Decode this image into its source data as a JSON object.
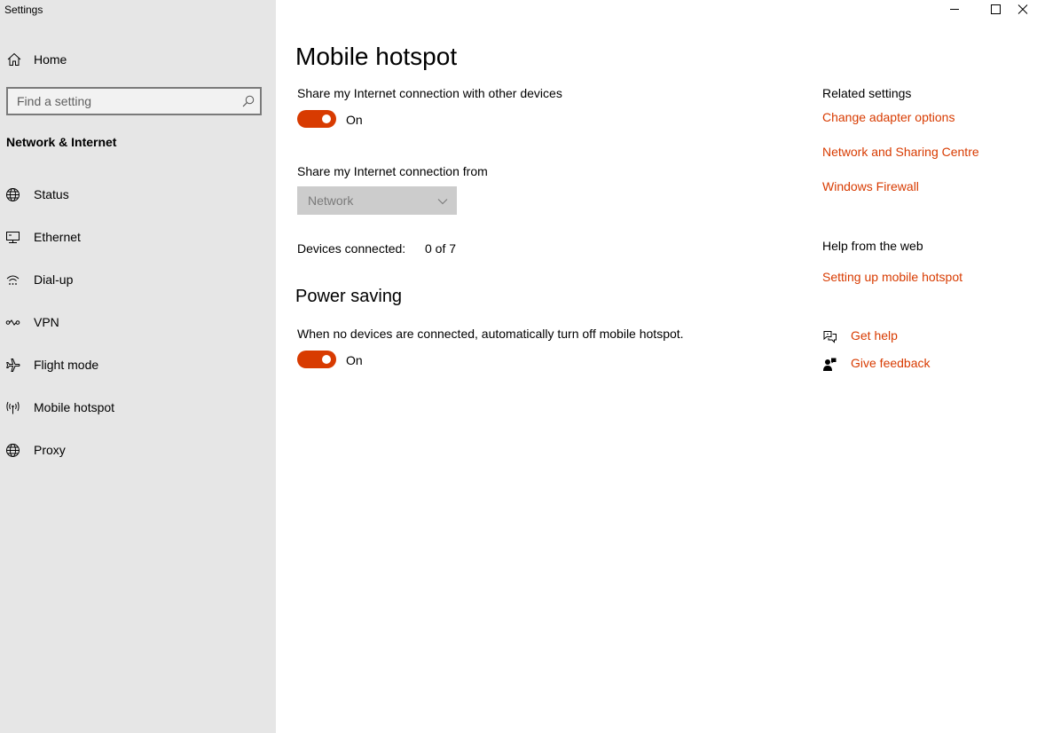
{
  "window": {
    "app_title": "Settings",
    "controls": {
      "minimize_icon": "minimize-icon",
      "maximize_icon": "maximize-icon",
      "close_icon": "close-icon"
    }
  },
  "sidebar": {
    "home_label": "Home",
    "search_placeholder": "Find a setting",
    "section_title": "Network & Internet",
    "items": [
      {
        "label": "Status",
        "icon": "globe-status-icon"
      },
      {
        "label": "Ethernet",
        "icon": "ethernet-icon"
      },
      {
        "label": "Dial-up",
        "icon": "dialup-icon"
      },
      {
        "label": "VPN",
        "icon": "vpn-icon"
      },
      {
        "label": "Flight mode",
        "icon": "airplane-icon"
      },
      {
        "label": "Mobile hotspot",
        "icon": "hotspot-icon"
      },
      {
        "label": "Proxy",
        "icon": "globe-icon"
      }
    ]
  },
  "main": {
    "title": "Mobile hotspot",
    "share_label": "Share my Internet connection with other devices",
    "share_toggle": {
      "state_label": "On",
      "on": true
    },
    "share_from_label": "Share my Internet connection from",
    "share_from_value": "Network",
    "devices_label": "Devices connected:",
    "devices_value": "0 of 7",
    "power_title": "Power saving",
    "power_label": "When no devices are connected, automatically turn off mobile hotspot.",
    "power_toggle": {
      "state_label": "On",
      "on": true
    }
  },
  "related": {
    "title": "Related settings",
    "links": [
      "Change adapter options",
      "Network and Sharing Centre",
      "Windows Firewall"
    ],
    "help_title": "Help from the web",
    "help_links": [
      "Setting up mobile hotspot"
    ],
    "get_help": "Get help",
    "give_feedback": "Give feedback"
  },
  "colors": {
    "accent": "#d83b01",
    "sidebar_bg": "#e6e6e6",
    "dropdown_disabled_bg": "#cccccc"
  }
}
